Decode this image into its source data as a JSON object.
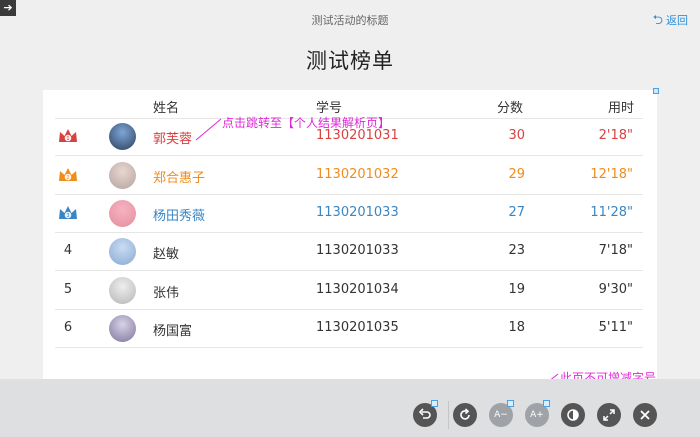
{
  "window": {
    "corner_icon": "exit-arrow-icon",
    "top_title": "测试活动的标题",
    "back_label": "返回"
  },
  "board": {
    "title": "测试榜单",
    "headers": {
      "name": "姓名",
      "student_id": "学号",
      "score": "分数",
      "time": "用时"
    },
    "rows": [
      {
        "rank": "1",
        "name": "郭芙蓉",
        "student_id": "1130201031",
        "score": "30",
        "time": "2'18\"",
        "color": "#d9413f"
      },
      {
        "rank": "2",
        "name": "郑合惠子",
        "student_id": "1130201032",
        "score": "29",
        "time": "12'18\"",
        "color": "#f08c1c"
      },
      {
        "rank": "3",
        "name": "杨田秀薇",
        "student_id": "1130201033",
        "score": "27",
        "time": "11'28\"",
        "color": "#3a86c4"
      },
      {
        "rank": "4",
        "name": "赵敏",
        "student_id": "1130201033",
        "score": "23",
        "time": "7'18\"",
        "color": "#333333"
      },
      {
        "rank": "5",
        "name": "张伟",
        "student_id": "1130201034",
        "score": "19",
        "time": "9'30\"",
        "color": "#333333"
      },
      {
        "rank": "6",
        "name": "杨国富",
        "student_id": "1130201035",
        "score": "18",
        "time": "5'11\"",
        "color": "#333333"
      }
    ]
  },
  "annotations": {
    "click_hint": "点击跳转至【个人结果解析页】",
    "font_hint": "此页不可增减字号"
  },
  "toolbar": {
    "icons": [
      "undo-icon",
      "refresh-icon",
      "font-decrease-icon",
      "font-increase-icon",
      "contrast-icon",
      "fullscreen-icon",
      "close-icon"
    ],
    "font_decrease": "A−",
    "font_increase": "A+"
  },
  "colors": {
    "accent": "#2f8fd8",
    "gold": "#f08c1c",
    "red": "#d9413f",
    "blue": "#3a86c4",
    "annotation": "#e028d8"
  }
}
